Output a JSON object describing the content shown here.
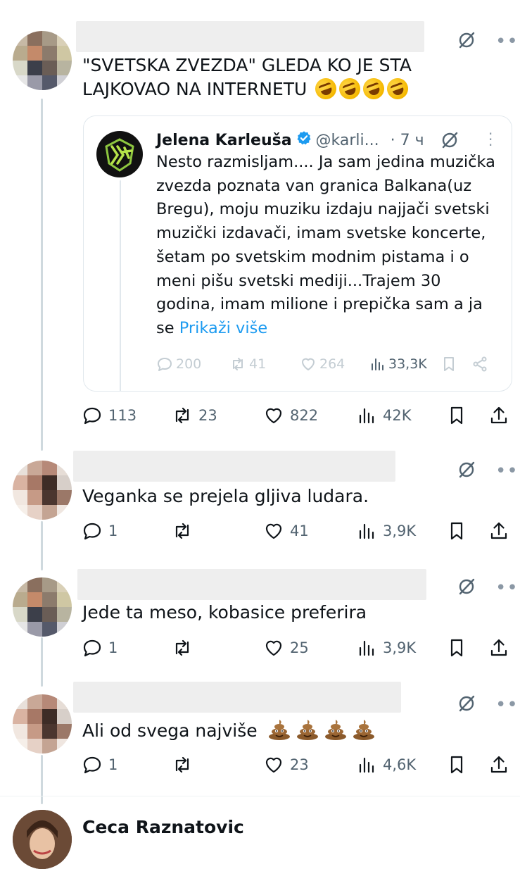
{
  "post": {
    "text": "\"SVETSKA ZVEZDA\" GLEDA KO JE STA LAJKOVAO NA INTERNETU",
    "emojis": [
      "rolling-on-floor-laughing",
      "rolling-on-floor-laughing",
      "rolling-on-floor-laughing",
      "rolling-on-floor-laughing"
    ],
    "actions": {
      "replies": "113",
      "reposts": "23",
      "likes": "822",
      "views": "42K"
    }
  },
  "quote": {
    "author_name": "Jelena Karleuša",
    "handle": "@karli...",
    "time": "· 7 ч",
    "verified": true,
    "text": "Nesto razmisljam.... Ja sam jedina muzička zvezda poznata van granica Balkana(uz Bregu), moju muziku izdaju najjači svetski muzički izdavači, imam svetske koncerte, šetam po svetskim modnim pistama i o meni pišu svetski mediji...Trajem 30 godina, imam milione i prepička sam a ja se",
    "show_more": "Prikaži više",
    "actions": {
      "replies": "200",
      "reposts": "41",
      "likes": "264",
      "views": "33,3K"
    }
  },
  "replies": [
    {
      "text": "Veganka se prejela gljiva ludara.",
      "actions": {
        "replies": "1",
        "reposts": "",
        "likes": "41",
        "views": "3,9K"
      }
    },
    {
      "text": "Jede ta meso, kobasice preferira",
      "actions": {
        "replies": "1",
        "reposts": "",
        "likes": "25",
        "views": "3,9K"
      }
    },
    {
      "text": "Ali od svega najviše",
      "emojis": [
        "pile-of-poo",
        "pile-of-poo",
        "pile-of-poo",
        "pile-of-poo"
      ],
      "actions": {
        "replies": "1",
        "reposts": "",
        "likes": "23",
        "views": "4,6K"
      }
    }
  ],
  "next_user": {
    "name": "Ceca Raznatovic"
  },
  "colors": {
    "text": "#0f1419",
    "secondary": "#536471",
    "link": "#1d9bf0",
    "verified": "#1d9bf0",
    "thread_line": "#cfd9de"
  }
}
